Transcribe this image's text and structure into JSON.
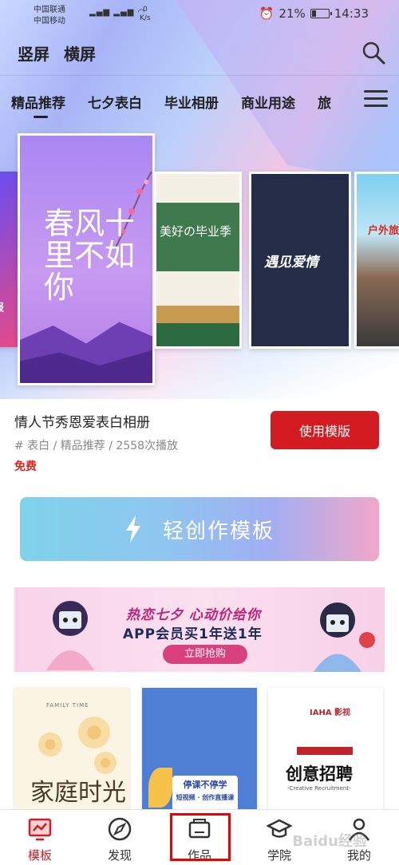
{
  "status_bar": {
    "carrier1": "中国联通",
    "carrier2": "中国移动",
    "network": "4G 2G",
    "speed_value": "0",
    "speed_unit": "K/s",
    "battery": "21%",
    "time": "14:33"
  },
  "header": {
    "portrait": "竖屏",
    "landscape": "横屏"
  },
  "categories": [
    "精品推荐",
    "七夕表白",
    "毕业相册",
    "商业用途",
    "旅"
  ],
  "carousel": {
    "left_card_text": "报",
    "main_card_text": "春风十里不如你",
    "grad_card_text": "美好の毕业季",
    "love_card_text": "遇见爱情",
    "right_card_text": "户外旅"
  },
  "template": {
    "title": "情人节秀恩爱表白相册",
    "meta": "# 表白 / 精品推荐 / 2558次播放",
    "price": "免费",
    "use_button": "使用模版"
  },
  "quick_create": {
    "label": "轻创作模板"
  },
  "banner": {
    "line1": "热恋七夕  心动价给你",
    "line2": "APP会员买1年送1年",
    "cta": "立即抢购"
  },
  "thumbnails": [
    {
      "caption": "FAMILY TIME",
      "title": "家庭时光"
    },
    {
      "title": "停课不停学",
      "subtitle": "短视频 · 创作直播课"
    },
    {
      "brand": "IAHA 影视",
      "title": "创意招聘",
      "subtitle": "-Creative Recruitment-"
    }
  ],
  "tabbar": {
    "items": [
      "模板",
      "发现",
      "作品",
      "学院",
      "我的"
    ]
  },
  "watermark": "Baidu经验",
  "colors": {
    "accent": "#d31c22",
    "highlight_box": "#ee0000"
  }
}
